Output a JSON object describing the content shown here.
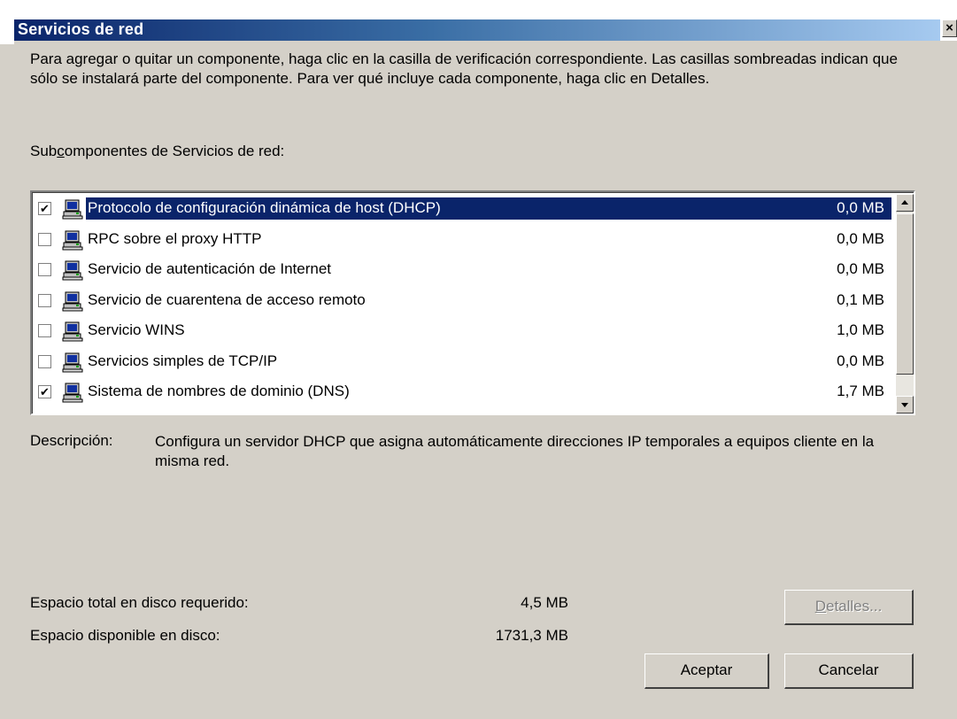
{
  "window": {
    "title": "Servicios de red",
    "close_label": "×"
  },
  "intro_text": "Para agregar o quitar un componente, haga clic en la casilla de verificación correspondiente. Las casillas sombreadas indican que sólo se instalará parte del componente. Para ver qué incluye cada componente, haga clic en Detalles.",
  "subcomponents_label_pre": "Sub",
  "subcomponents_label_key": "c",
  "subcomponents_label_post": "omponentes de Servicios de red:",
  "components": [
    {
      "label": "Protocolo de configuración dinámica de host (DHCP)",
      "size": "0,0 MB",
      "checked": true,
      "selected": true
    },
    {
      "label": "RPC sobre el proxy HTTP",
      "size": "0,0 MB",
      "checked": false,
      "selected": false
    },
    {
      "label": "Servicio de autenticación de Internet",
      "size": "0,0 MB",
      "checked": false,
      "selected": false
    },
    {
      "label": "Servicio de cuarentena de acceso remoto",
      "size": "0,1 MB",
      "checked": false,
      "selected": false
    },
    {
      "label": "Servicio WINS",
      "size": "1,0 MB",
      "checked": false,
      "selected": false
    },
    {
      "label": "Servicios simples de TCP/IP",
      "size": "0,0 MB",
      "checked": false,
      "selected": false
    },
    {
      "label": "Sistema de nombres de dominio (DNS)",
      "size": "1,7 MB",
      "checked": true,
      "selected": false
    }
  ],
  "description": {
    "label": "Descripción:",
    "text": "Configura un servidor DHCP que asigna automáticamente direcciones IP temporales a equipos cliente en la misma red."
  },
  "disk": {
    "required_label": "Espacio total en disco requerido:",
    "required_value": "4,5 MB",
    "available_label": "Espacio disponible en disco:",
    "available_value": "1731,3 MB"
  },
  "buttons": {
    "details_key": "D",
    "details_rest": "etalles...",
    "ok": "Aceptar",
    "cancel": "Cancelar"
  },
  "icons": {
    "component": "computer-network-icon",
    "close": "close-icon"
  },
  "colors": {
    "selection": "#0a246a",
    "title_gradient_start": "#0a246a",
    "title_gradient_end": "#a6caf0",
    "face": "#d4d0c8"
  }
}
